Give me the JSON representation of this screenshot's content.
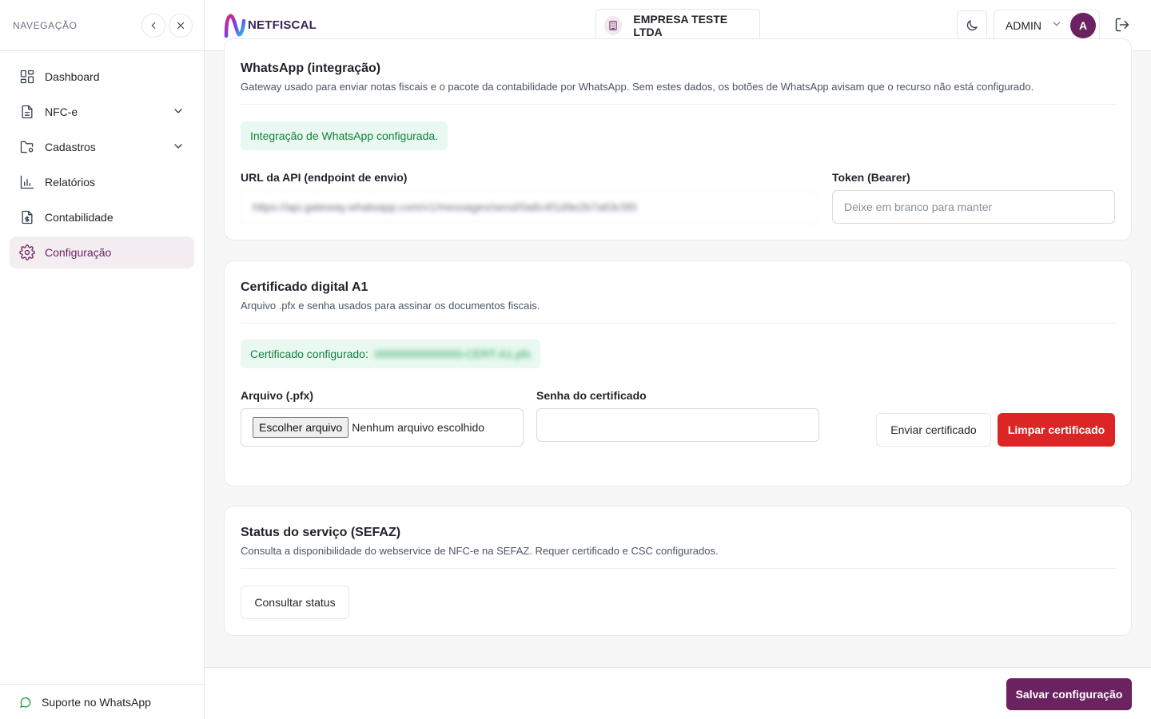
{
  "sidebar": {
    "title": "NAVEGAÇÃO",
    "items": [
      {
        "label": "Dashboard",
        "icon": "grid-icon"
      },
      {
        "label": "NFC-e",
        "icon": "document-icon",
        "expandable": true
      },
      {
        "label": "Cadastros",
        "icon": "folder-settings-icon",
        "expandable": true
      },
      {
        "label": "Relatórios",
        "icon": "bar-chart-icon"
      },
      {
        "label": "Contabilidade",
        "icon": "file-dollar-icon"
      },
      {
        "label": "Configuração",
        "icon": "gear-icon",
        "active": true
      }
    ],
    "footer": "Suporte no WhatsApp"
  },
  "header": {
    "logo_text": "NETFISCAL",
    "company": "EMPRESA TESTE LTDA",
    "user": "ADMIN",
    "avatar": "A"
  },
  "whatsapp": {
    "title": "WhatsApp (integração)",
    "description": "Gateway usado para enviar notas fiscais e o pacote da contabilidade por WhatsApp. Sem estes dados, os botões de WhatsApp avisam que o recurso não está configurado.",
    "status": "Integração de WhatsApp configurada.",
    "url_label": "URL da API (endpoint de envio)",
    "url_value": "https://api.gateway.whatsapp.com/v1/messages/send/0a8c4f1d9e2b7a63c5f0",
    "token_label": "Token (Bearer)",
    "token_placeholder": "Deixe em branco para manter"
  },
  "certificate": {
    "title": "Certificado digital A1",
    "description": "Arquivo .pfx e senha usados para assinar os documentos fiscais.",
    "status_label": "Certificado configurado:",
    "status_value": "00000000000000-CERT-A1.pfx",
    "file_label": "Arquivo (.pfx)",
    "file_button": "Escolher arquivo",
    "file_none": "Nenhum arquivo escolhido",
    "password_label": "Senha do certificado",
    "send_button": "Enviar certificado",
    "clear_button": "Limpar certificado"
  },
  "sefaz": {
    "title": "Status do serviço (SEFAZ)",
    "description": "Consulta a disponibilidade do webservice de NFC-e na SEFAZ. Requer certificado e CSC configurados.",
    "button": "Consultar status"
  },
  "footer": {
    "save_button": "Salvar configuração"
  },
  "colors": {
    "brand": "#6b2260",
    "danger": "#dc2626",
    "success_bg": "#e9f8f0",
    "success_text": "#15803d"
  }
}
